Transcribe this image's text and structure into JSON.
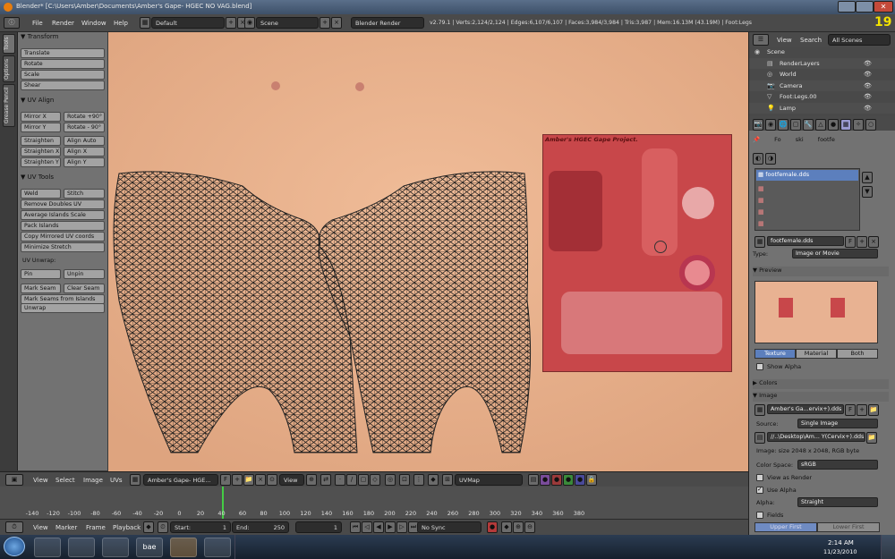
{
  "window": {
    "title": "Blender* [C:\\Users\\Amber\\Documents\\Amber's Gape- HGEC NO VAG.blend]"
  },
  "menubar": {
    "items": [
      "File",
      "Render",
      "Window",
      "Help"
    ],
    "layout": "Default",
    "scene": "Scene",
    "engine": "Blender Render",
    "stats": "v2.79.1 | Verts:2,124/2,124 | Edges:6,107/6,107 | Faces:3,984/3,984 | Tris:3,987 | Mem:16.13M (43.19M) | Foot:Legs"
  },
  "frame_counter": "19",
  "tabs": [
    "Tools",
    "Options",
    "Grease Pencil"
  ],
  "toolshelf": {
    "transform": {
      "header": "Transform",
      "buttons": [
        "Translate",
        "Rotate",
        "Scale",
        "Shear"
      ]
    },
    "uv_align": {
      "header": "UV Align",
      "mirror_x": "Mirror X",
      "rotate_p90": "Rotate +90°",
      "mirror_y": "Mirror Y",
      "rotate_m90": "Rotate - 90°",
      "straighten": "Straighten",
      "align_auto": "Align Auto",
      "straighten_x": "Straighten X",
      "align_x": "Align X",
      "straighten_y": "Straighten Y",
      "align_y": "Align Y"
    },
    "uv_tools": {
      "header": "UV Tools",
      "weld": "Weld",
      "stitch": "Stitch",
      "buttons": [
        "Remove Doubles UV",
        "Average Islands Scale",
        "Pack Islands",
        "Copy Mirrored UV coords",
        "Minimize Stretch"
      ],
      "unwrap_label": "UV Unwrap:",
      "pin": "Pin",
      "unpin": "Unpin",
      "mark_seam": "Mark Seam",
      "clear_seam": "Clear Seam",
      "seams_from_islands": "Mark Seams from Islands",
      "unwrap": "Unwrap"
    }
  },
  "texture_overlay": {
    "title": "Amber's HGEC Gape Project."
  },
  "uv_header": {
    "items": [
      "View",
      "Select",
      "Image",
      "UVs"
    ],
    "image_name": "Amber's Gape- HGE...",
    "view": "View",
    "uvmap": "UVMap"
  },
  "timeline": {
    "ticks": [
      "-140",
      "-120",
      "-100",
      "-80",
      "-60",
      "-40",
      "-20",
      "0",
      "20",
      "40",
      "60",
      "80",
      "100",
      "120",
      "140",
      "160",
      "180",
      "200",
      "220",
      "240",
      "260",
      "280",
      "300",
      "320",
      "340",
      "360",
      "380"
    ],
    "current_frame_marker": 0
  },
  "timeline_bar": {
    "items": [
      "View",
      "Marker",
      "Frame",
      "Playback"
    ],
    "start_label": "Start:",
    "start_value": "1",
    "end_label": "End:",
    "end_value": "250",
    "current": "1",
    "sync": "No Sync"
  },
  "outliner": {
    "view": "View",
    "search": "Search",
    "scope": "All Scenes",
    "items": [
      {
        "label": "Scene",
        "indent": 0
      },
      {
        "label": "RenderLayers",
        "indent": 1
      },
      {
        "label": "World",
        "indent": 1
      },
      {
        "label": "Camera",
        "indent": 1
      },
      {
        "label": "Foot:Legs.00",
        "indent": 1
      },
      {
        "label": "Lamp",
        "indent": 1
      }
    ]
  },
  "properties": {
    "breadcrumb": [
      "Fo",
      "ski",
      "footfe"
    ],
    "texture_slot": "footfemale.dds",
    "texture_name": "footfemale.dds",
    "f_label": "F",
    "type_label": "Type:",
    "type_value": "Image or Movie",
    "preview_header": "Preview",
    "preview_tabs": [
      "Texture",
      "Material",
      "Both"
    ],
    "show_alpha": "Show Alpha",
    "colors_header": "Colors",
    "image_header": "Image",
    "image_name": "Amber's Ga...ervix+).dds",
    "source_label": "Source:",
    "source_value": "Single Image",
    "filepath": "//..\\Desktop\\Am... Y(Cervix+).dds",
    "image_info": "Image: size 2048 x 2048, RGB byte",
    "color_space_label": "Color Space:",
    "color_space_value": "sRGB",
    "view_as_render": "View as Render",
    "use_alpha": "Use Alpha",
    "alpha_label": "Alpha:",
    "alpha_value": "Straight",
    "fields": "Fields",
    "upper_first": "Upper First",
    "lower_first": "Lower First"
  },
  "taskbar": {
    "time": "2:14 AM",
    "date": "11/23/2010",
    "app_bae": "bae"
  }
}
